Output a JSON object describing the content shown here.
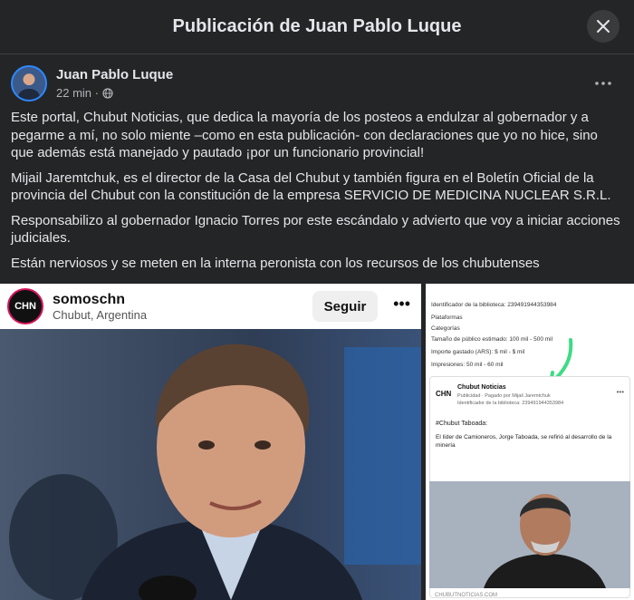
{
  "modal": {
    "title": "Publicación de Juan Pablo Luque",
    "close_icon": "close-icon"
  },
  "post": {
    "author": "Juan Pablo Luque",
    "time": "22 min ·",
    "privacy_icon": "globe-icon",
    "more_icon": "more-options-icon",
    "paragraphs": [
      "Este portal, Chubut Noticias, que dedica la mayoría de los posteos a endulzar al gobernador y a pegarme a mí, no solo miente –como en esta publicación- con declaraciones que yo no hice, sino que además está manejado y pautado ¡por un funcionario provincial!",
      "Mijail Jaremtchuk, es el director de la Casa del Chubut y también figura en el Boletín Oficial de la provincia del Chubut con la constitución de la empresa SERVICIO DE MEDICINA NUCLEAR S.R.L.",
      "Responsabilizo al gobernador Ignacio Torres por este escándalo y advierto que voy a iniciar acciones judiciales.",
      "Están nerviosos y se meten en la interna peronista con los recursos de los chubutenses"
    ]
  },
  "left_image": {
    "logo_text": "CHN",
    "username": "somoschn",
    "location": "Chubut, Argentina",
    "follow_label": "Seguir",
    "dots": "•••"
  },
  "right_image": {
    "library_id": "Identificador de la biblioteca: 239491944353984",
    "platforms": "Plataformas",
    "categories": "Categorías",
    "audience": "Tamaño de público estimado: 100 mil - 500 mil",
    "spent": "Importe gastado (ARS): $ mil - $ mil",
    "impressions": "Impresiones: 50 mil - 60 mil",
    "card_logo": "CHN",
    "page_name": "Chubut Noticias",
    "paid_by": "Publicidad · Pagado por Mijail Jaremtchuk",
    "card_library": "Identificador de la biblioteca: 239491944353984",
    "hashtag": "#Chubut Taboada:",
    "body": "El líder de Camioneros, Jorge Taboada, se refirió al desarrollo de la minería",
    "url": "CHUBUTNOTICIAS.COM"
  },
  "colors": {
    "background": "#242526",
    "text": "#e4e6eb",
    "meta": "#b0b3b8",
    "annotation_arrow": "#3ddc84"
  }
}
